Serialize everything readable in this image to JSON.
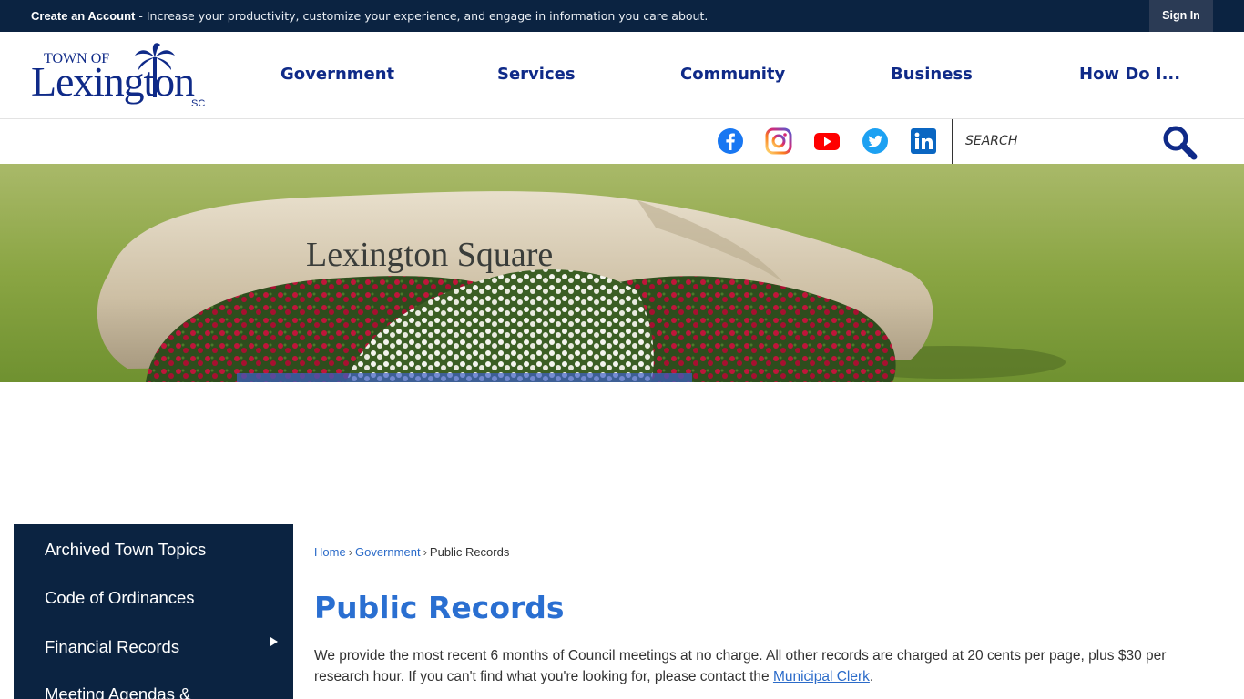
{
  "topbar": {
    "create_account": "Create an Account",
    "message": " - Increase your productivity, customize your experience, and engage in information you care about.",
    "sign_in": "Sign In"
  },
  "logo": {
    "town_of": "TOWN OF",
    "name": "Lexington",
    "state": "SC"
  },
  "nav": [
    {
      "label": "Government"
    },
    {
      "label": "Services"
    },
    {
      "label": "Community"
    },
    {
      "label": "Business"
    },
    {
      "label": "How Do I..."
    }
  ],
  "social": [
    {
      "name": "facebook-icon",
      "color": "#1877f2"
    },
    {
      "name": "instagram-icon",
      "color": "#d62976"
    },
    {
      "name": "youtube-icon",
      "color": "#ff0000"
    },
    {
      "name": "twitter-icon",
      "color": "#1da1f2"
    },
    {
      "name": "linkedin-icon",
      "color": "#0a66c2"
    }
  ],
  "search": {
    "placeholder": "SEARCH",
    "icon": "magnifier-icon"
  },
  "banner": {
    "sign_text": "Lexington Square"
  },
  "sidebar": {
    "items": [
      {
        "label": "Archived Town Topics"
      },
      {
        "label": "Code of Ordinances"
      },
      {
        "label": "Financial Records",
        "has_submenu": true
      },
      {
        "label": "Meeting Agendas &"
      }
    ]
  },
  "breadcrumb": {
    "items": [
      "Home",
      "Government",
      "Public Records"
    ]
  },
  "main": {
    "title": "Public Records",
    "intro": "We provide the most recent 6 months of Council meetings at no charge. All other records are charged at 20 cents per page, plus $30 per research hour. If you can't find what you're looking for, please contact the ",
    "link": "Municipal Clerk",
    "end": "."
  },
  "colors": {
    "navy": "#0b2341",
    "nav_blue": "#0f2a88",
    "title_blue": "#2a6fd1"
  }
}
